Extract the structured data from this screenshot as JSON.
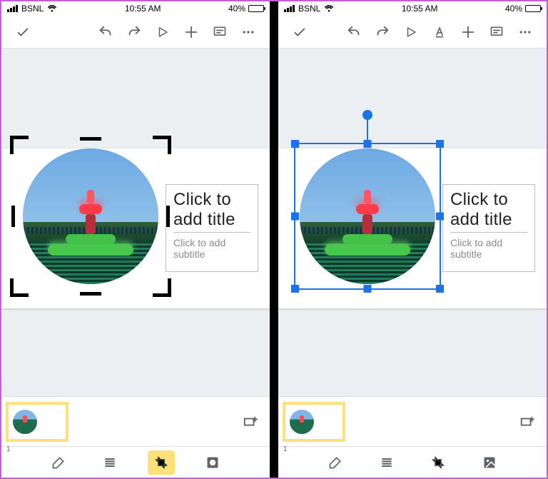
{
  "status": {
    "carrier": "BSNL",
    "time": "10:55 AM",
    "battery_text": "40%"
  },
  "slide": {
    "title_placeholder": "Click to add title",
    "subtitle_placeholder": "Click to add subtitle"
  },
  "filmstrip": {
    "slide_number": "1"
  }
}
